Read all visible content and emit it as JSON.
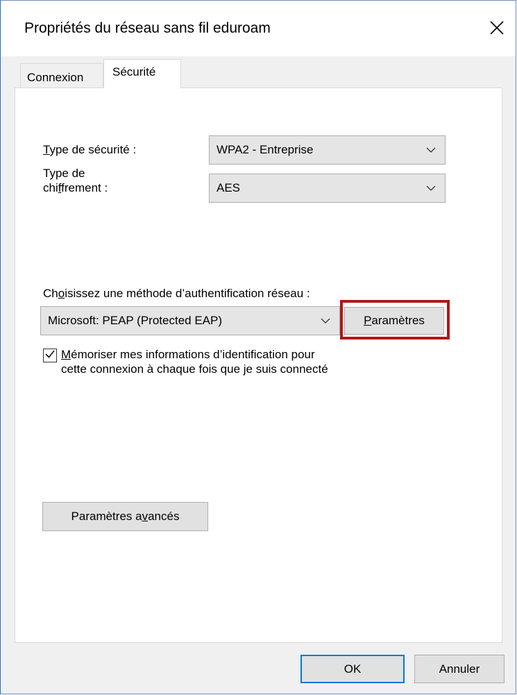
{
  "window": {
    "title": "Propriétés du réseau sans fil eduroam",
    "close_glyph": "✕"
  },
  "tabs": [
    {
      "label": "Connexion",
      "selected": false
    },
    {
      "label": "Sécurité",
      "selected": true
    }
  ],
  "security": {
    "type_label_underlined": "T",
    "type_label_rest": "ype de sécurité :",
    "type_value": "WPA2 - Entreprise",
    "encryption_label_line1": "Type de",
    "encryption_label_pre": "chi",
    "encryption_label_underlined": "f",
    "encryption_label_post": "frement :",
    "encryption_value": "AES"
  },
  "auth": {
    "label_pre": "Ch",
    "label_underlined": "o",
    "label_post": "isissez une méthode d’authentification réseau :",
    "method_value": "Microsoft: PEAP (Protected EAP)",
    "settings_underlined": "P",
    "settings_rest": "aramètres",
    "remember_checked": true,
    "remember_underlined": "M",
    "remember_line1_rest": "émoriser mes informations d’identification pour",
    "remember_line2": "cette connexion à chaque fois que je suis connecté"
  },
  "advanced": {
    "label_pre": "Paramètres a",
    "label_underlined": "v",
    "label_post": "ancés"
  },
  "footer": {
    "ok_label": "OK",
    "cancel_label": "Annuler"
  },
  "colors": {
    "highlight": "#b01717",
    "ok_border": "#0078d7"
  }
}
